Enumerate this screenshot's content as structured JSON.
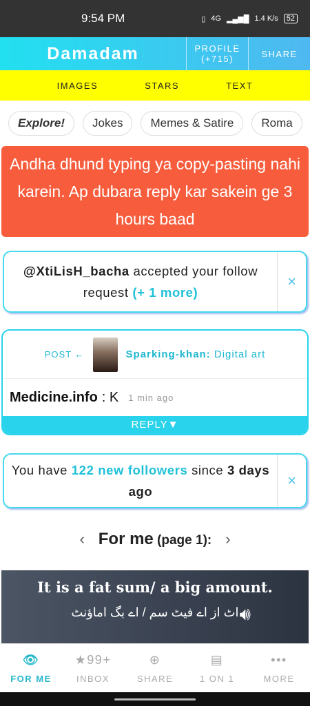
{
  "status": {
    "time": "9:54 PM",
    "network": "4G",
    "speed": "1.4 K/s",
    "battery": "52"
  },
  "header": {
    "brand": "Damadam",
    "profile_label": "PROFILE",
    "profile_count": "(+715)",
    "share_label": "SHARE"
  },
  "subnav": [
    "IMAGES",
    "STARS",
    "TEXT"
  ],
  "chips": [
    "Explore!",
    "Jokes",
    "Memes & Satire",
    "Roma"
  ],
  "warning": "Andha dhund typing ya copy-pasting nahi karein. Ap dubara reply kar sakein ge 3 hours baad",
  "follow_notif": {
    "user": "@XtiLisH_bacha",
    "text1": " accepted your follow request ",
    "more": "(+ 1 more)",
    "close": "×"
  },
  "post": {
    "label": "POST ←",
    "author": "Sparking-khan:",
    "category": " Digital art",
    "commenter": "Medicine.info",
    "comment": ": K",
    "time": "1 min ago",
    "reply": "REPLY▼"
  },
  "followers_notif": {
    "pre": "You have ",
    "count": "122 new followers",
    "mid": " since ",
    "days": "3 days ago",
    "close": "×"
  },
  "feed": {
    "prev": "‹",
    "title": "For me",
    "page": " (page 1):",
    "next": "›"
  },
  "image_post": {
    "title": "It is a fat sum/ a big amount.",
    "urdu": "اٹ از اے فیٹ سم / اے بگ اماؤنٹ"
  },
  "bottom_nav": [
    {
      "icon": "👁",
      "label": "FOR ME"
    },
    {
      "icon": "★99+",
      "label": "INBOX"
    },
    {
      "icon": "⊕",
      "label": "SHARE"
    },
    {
      "icon": "▤",
      "label": "1 ON 1"
    },
    {
      "icon": "•••",
      "label": "MORE"
    }
  ],
  "colors": {
    "accent": "#2ad3ec",
    "warning": "#f75d3d",
    "subnav": "#ffff00"
  }
}
